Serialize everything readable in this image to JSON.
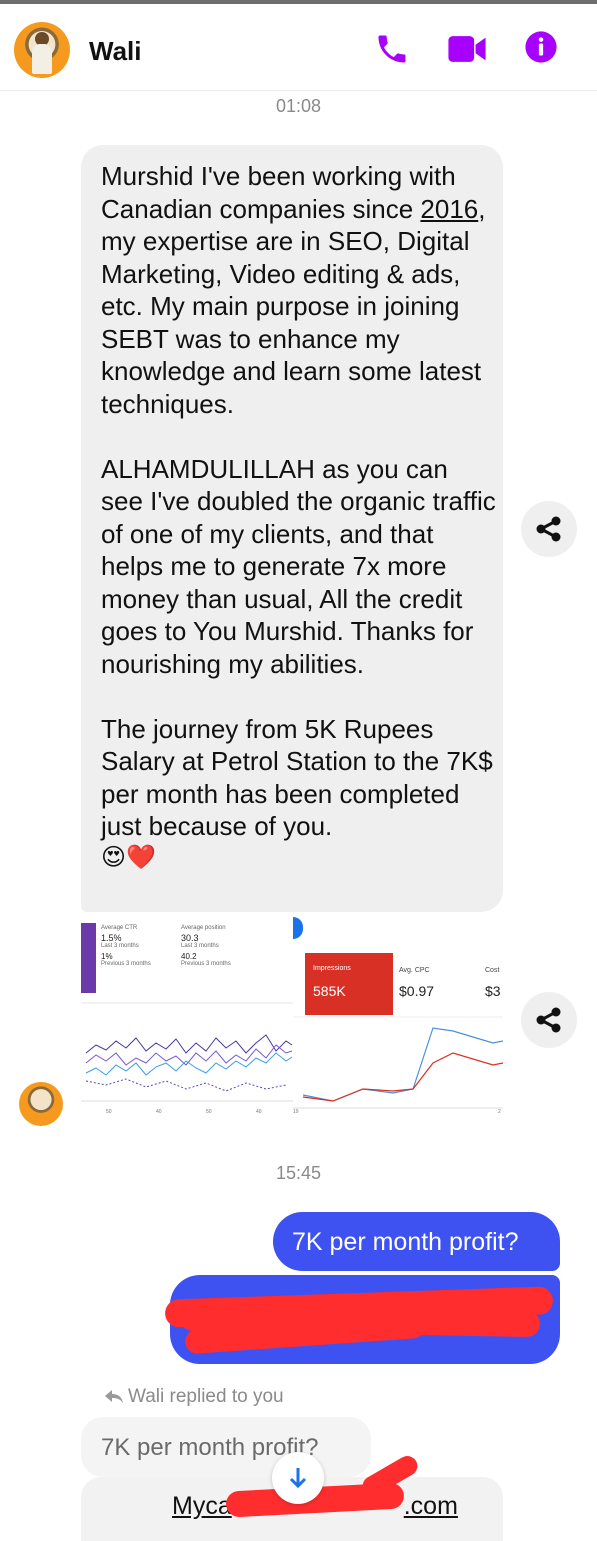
{
  "header": {
    "contact_name": "Wali",
    "icons": [
      "phone-icon",
      "video-camera-icon",
      "info-icon"
    ],
    "accent": "#a800ff"
  },
  "timestamps": [
    "01:08",
    "15:45"
  ],
  "incoming": {
    "paragraphs": [
      {
        "before": "Murshid I've been working with Canadian companies since ",
        "underlined": "2016",
        "after": ", my expertise are in SEO, Digital Marketing, Video editing & ads, etc. My main purpose in joining SEBT was to enhance my knowledge and learn some latest techniques."
      },
      {
        "text": "ALHAMDULILLAH as you can see I've doubled the organic traffic of one of my clients, and that helps me to generate 7x more money than usual, All the credit goes to You Murshid. Thanks for nourishing my abilities."
      },
      {
        "text": "The journey from 5K Rupees Salary at Petrol Station to the 7K$ per month has been completed just because of you."
      }
    ],
    "emojis": "😍❤️",
    "bubble_color": "#efefef"
  },
  "analytics_image": {
    "left_panel": {
      "metric1": {
        "label": "Average CTR",
        "value": "1.5%",
        "period": "Last 3 months",
        "prev_value": "1%",
        "prev_period": "Previous 3 months"
      },
      "metric2": {
        "label": "Average position",
        "value": "30.3",
        "period": "Last 3 months",
        "prev_value": "40.2",
        "prev_period": "Previous 3 months"
      },
      "axis_ticks": [
        "50",
        "40",
        "50",
        "40"
      ]
    },
    "right_panel": {
      "impressions_label": "Impressions",
      "impressions_value": "585K",
      "cpc_label": "Avg. CPC",
      "cpc_value": "$0.97",
      "cost_label": "Cost",
      "cost_value": "$3",
      "axis_start": "19",
      "axis_end": "2"
    }
  },
  "outgoing": {
    "message1": "7K per month profit?",
    "bubble_color": "#3d52f1"
  },
  "reply": {
    "label": "Wali replied to you",
    "quoted": "7K per month profit?",
    "link_start": "Myca",
    "link_end": ".com"
  }
}
